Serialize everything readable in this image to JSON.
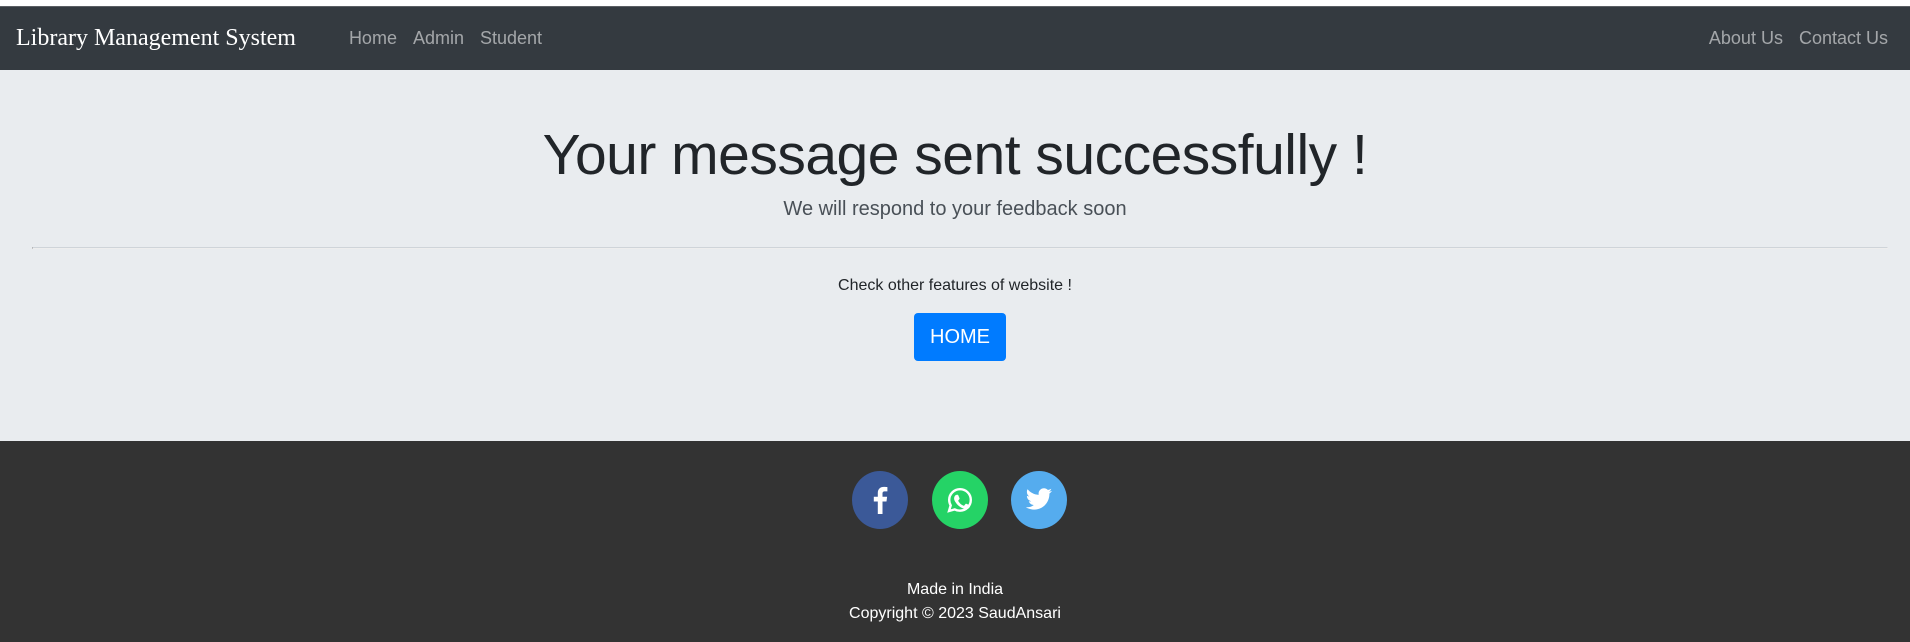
{
  "navbar": {
    "brand": "Library Management System",
    "left_links": [
      "Home",
      "Admin",
      "Student"
    ],
    "right_links": [
      "About Us",
      "Contact Us"
    ]
  },
  "main": {
    "heading": "Your message sent successfully !",
    "lead": "We will respond to your feedback soon",
    "check_text": "Check other features of website !",
    "home_button": "HOME"
  },
  "footer": {
    "social_icons": [
      "facebook-icon",
      "whatsapp-icon",
      "twitter-icon"
    ],
    "made_in": "Made in India",
    "copyright": "Copyright © 2023 SaudAnsari"
  },
  "colors": {
    "navbar_bg": "#343a40",
    "page_bg": "#e9ecef",
    "button_primary": "#007bff",
    "footer_bg": "#333333",
    "facebook": "#3b5998",
    "whatsapp": "#25d366",
    "twitter": "#55acee"
  }
}
